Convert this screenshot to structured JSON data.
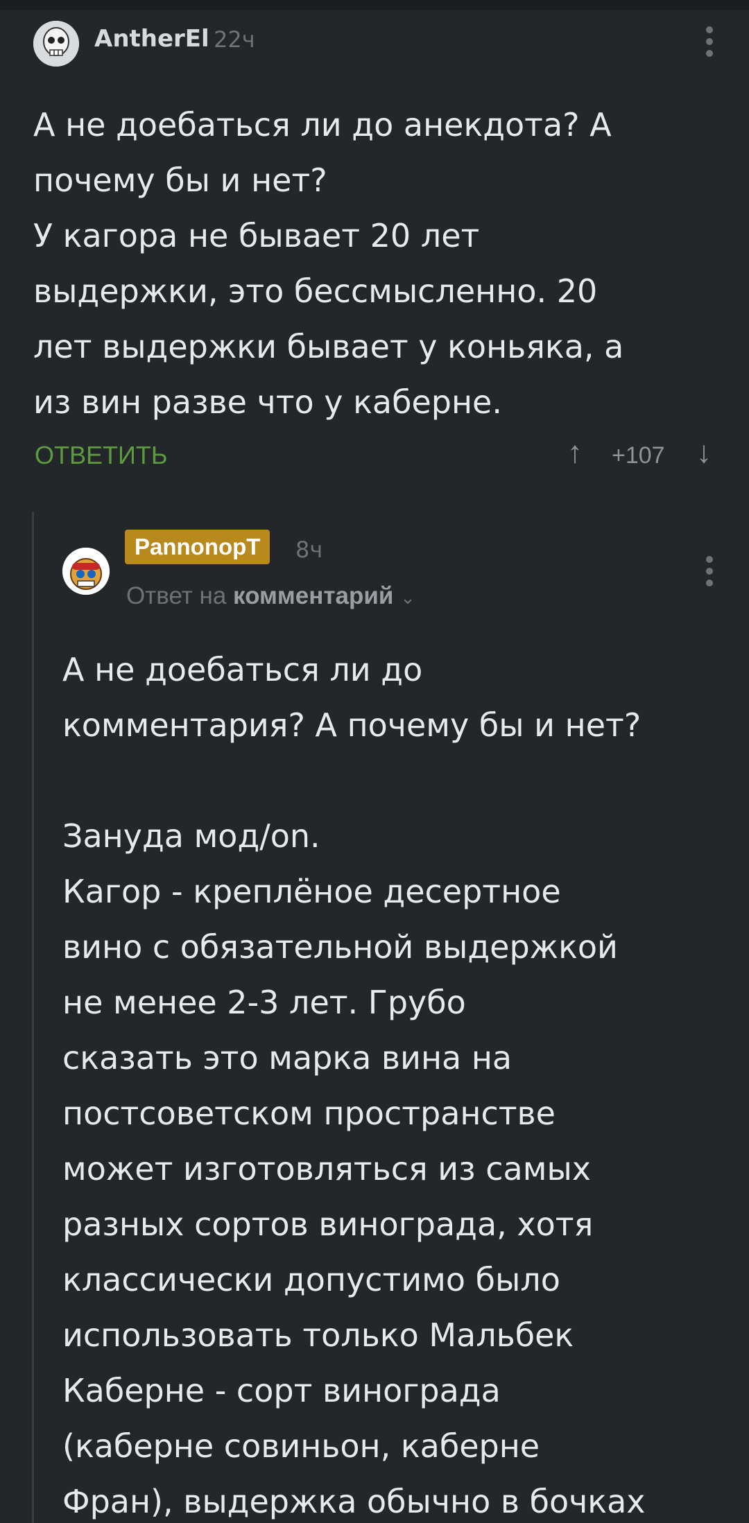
{
  "comment1": {
    "username": "AntherEl",
    "time": "22ч",
    "text": "А не доебаться ли до анекдота? А\nпочему бы и нет?\nУ кагора не бывает 20 лет\nвыдержки, это бессмысленно. 20\nлет выдержки бывает у коньяка, а\nиз вин разве что у каберне.",
    "reply_label": "ОТВЕТИТЬ",
    "up_arrow": "↑",
    "rating": "+107",
    "down_arrow": "↓"
  },
  "comment2": {
    "username": "PannonopT",
    "time": "8ч",
    "reply_to_prefix": "Ответ на",
    "reply_to_target": "комментарий",
    "chevron": "⌄",
    "text": "А не доебаться ли до\nкомментария? А почему бы и нет?\n\nЗануда мод/on.\nКагор - креплёное десертное\nвино с обязательной выдержкой\nне менее 2-3 лет. Грубо\nсказать это марка вина на\nпостсоветском пространстве\nможет изготовляться из самых\nразных сортов винограда, хотя\nклассически допустимо было\nиспользовать только Мальбек\nКаберне - сорт винограда\n(каберне совиньон, каберне\nФран), выдержка обычно в бочках"
  },
  "colors": {
    "background": "#24272a",
    "reply_green": "#5e9a3f",
    "badge_gold": "#b88a1e"
  },
  "icons": {
    "avatar1": "skull-avatar",
    "avatar2": "cartoon-avatar",
    "menu": "more-vertical-icon"
  }
}
